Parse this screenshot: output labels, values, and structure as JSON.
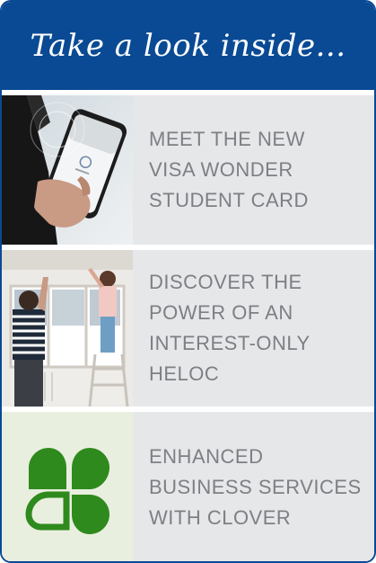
{
  "header": {
    "title": "Take a look inside..."
  },
  "items": [
    {
      "text_lines": [
        "MEET THE NEW",
        "VISA WONDER",
        "STUDENT CARD"
      ],
      "image": "phone-payment-photo"
    },
    {
      "text_lines": [
        "DISCOVER THE",
        "POWER OF AN",
        "INTEREST-ONLY",
        "HELOC"
      ],
      "image": "home-renovation-photo"
    },
    {
      "text_lines": [
        "ENHANCED",
        "BUSINESS SERVICES",
        "WITH CLOVER"
      ],
      "image": "clover-logo-icon"
    }
  ],
  "colors": {
    "header_bg": "#0a4a94",
    "row_bg": "#e6e7e9",
    "text": "#7d7f84",
    "clover_green": "#2f8a1e"
  }
}
